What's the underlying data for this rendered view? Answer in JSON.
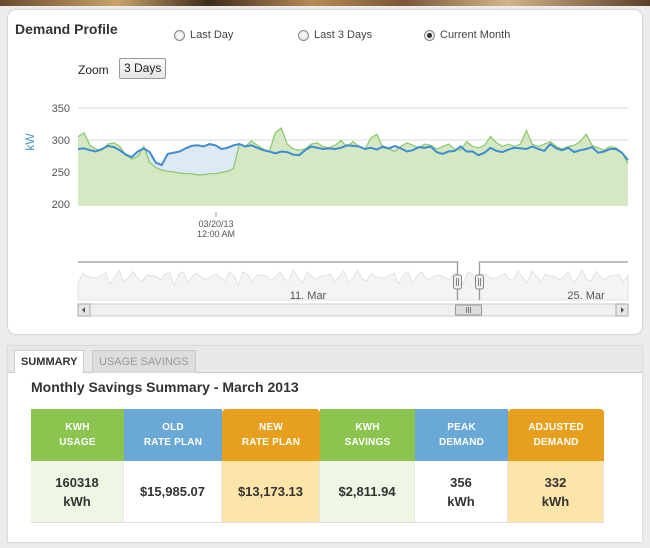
{
  "demand_profile": {
    "title": "Demand Profile",
    "radio_options": [
      {
        "label": "Last Day",
        "selected": false
      },
      {
        "label": "Last 3 Days",
        "selected": false
      },
      {
        "label": "Current Month",
        "selected": true
      }
    ],
    "zoom_label": "Zoom",
    "zoom_value": "3 Days"
  },
  "chart_data": {
    "type": "area",
    "ylabel": "kW",
    "yticks": [
      350,
      300,
      250,
      200
    ],
    "ylim": [
      190,
      360
    ],
    "x_tick_label_line1": "03/20/13",
    "x_tick_label_line2": "12:00 AM",
    "grid": true,
    "series": [
      {
        "name": "actual",
        "color": "#3f8ccf",
        "values": [
          292,
          293,
          290,
          288,
          292,
          297,
          295,
          290,
          283,
          279,
          288,
          293,
          287,
          270,
          266,
          284,
          286,
          288,
          293,
          297,
          298,
          296,
          300,
          298,
          292,
          294,
          298,
          300,
          296,
          298,
          294,
          290,
          288,
          285,
          288,
          287,
          283,
          282,
          290,
          296,
          294,
          292,
          293,
          292,
          294,
          298,
          297,
          296,
          292,
          294,
          291,
          296,
          293,
          297,
          293,
          288,
          290,
          295,
          294,
          296,
          287,
          284,
          288,
          289,
          296,
          288,
          288,
          282,
          286,
          294,
          289,
          287,
          291,
          294,
          293,
          292,
          296,
          292,
          289,
          300,
          293,
          290,
          294,
          287,
          290,
          292,
          295,
          286,
          288,
          292,
          292,
          286,
          274
        ]
      },
      {
        "name": "adjusted",
        "color": "#8cc66a",
        "values": [
          312,
          318,
          298,
          292,
          290,
          300,
          302,
          296,
          282,
          276,
          280,
          296,
          270,
          262,
          258,
          256,
          255,
          253,
          252,
          252,
          250,
          250,
          252,
          252,
          254,
          256,
          260,
          300,
          296,
          305,
          298,
          292,
          288,
          318,
          326,
          300,
          292,
          290,
          292,
          300,
          302,
          296,
          294,
          298,
          306,
          296,
          304,
          296,
          292,
          310,
          316,
          294,
          292,
          288,
          296,
          302,
          298,
          294,
          300,
          298,
          292,
          296,
          300,
          292,
          290,
          304,
          296,
          294,
          298,
          312,
          302,
          296,
          300,
          296,
          300,
          322,
          300,
          296,
          300,
          304,
          296,
          292,
          296,
          298,
          304,
          316,
          298,
          294,
          290,
          296,
          294,
          286,
          268
        ]
      }
    ],
    "navigator": {
      "tick_labels": [
        "11. Mar",
        "25. Mar"
      ],
      "selection_start": 0.69,
      "selection_end": 0.73
    }
  },
  "savings": {
    "tabs": [
      {
        "label": "SUMMARY",
        "active": true
      },
      {
        "label": "USAGE SAVINGS",
        "active": false
      }
    ],
    "title": "Monthly Savings Summary - March 2013",
    "columns": [
      {
        "head1": "KWH",
        "head2": "USAGE",
        "value1": "160318",
        "value2": "kWh",
        "head_color": "#8cc450",
        "cell_bg": "#eef6e4"
      },
      {
        "head1": "OLD",
        "head2": "RATE PLAN",
        "value1": "$15,985.07",
        "value2": "",
        "head_color": "#6aa8d6",
        "cell_bg": "#ffffff"
      },
      {
        "head1": "NEW",
        "head2": "RATE PLAN",
        "value1": "$13,173.13",
        "value2": "",
        "head_color": "#e6a01e",
        "cell_bg": "#fde4a8"
      },
      {
        "head1": "KWH",
        "head2": "SAVINGS",
        "value1": "$2,811.94",
        "value2": "",
        "head_color": "#8cc450",
        "cell_bg": "#eef6e4"
      },
      {
        "head1": "PEAK",
        "head2": "DEMAND",
        "value1": "356",
        "value2": "kWh",
        "head_color": "#6aa8d6",
        "cell_bg": "#ffffff"
      },
      {
        "head1": "ADJUSTED",
        "head2": "DEMAND",
        "value1": "332",
        "value2": "kWh",
        "head_color": "#e6a01e",
        "cell_bg": "#fde4a8"
      }
    ]
  }
}
